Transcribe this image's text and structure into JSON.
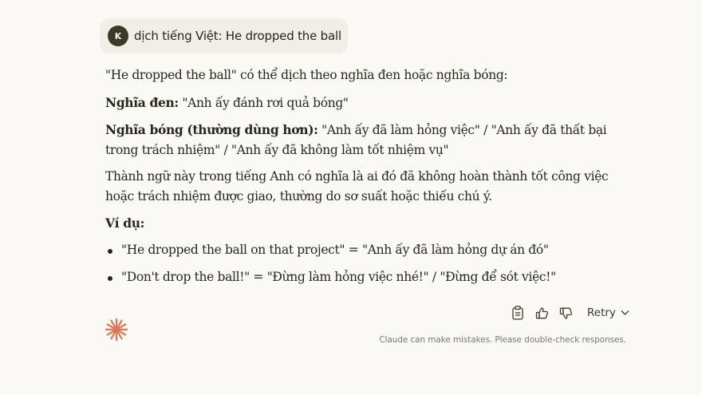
{
  "user_message": {
    "avatar_initial": "K",
    "text": "dịch tiếng Việt: He dropped the ball"
  },
  "response": {
    "intro": "\"He dropped the ball\" có thể dịch theo nghĩa đen hoặc nghĩa bóng:",
    "literal": {
      "label": "Nghĩa đen:",
      "text": " \"Anh ấy đánh rơi quả bóng\""
    },
    "figurative": {
      "label": "Nghĩa bóng (thường dùng hơn):",
      "text": " \"Anh ấy đã làm hỏng việc\" / \"Anh ấy đã thất bại trong trách nhiệm\" / \"Anh ấy đã không làm tốt nhiệm vụ\""
    },
    "explanation": "Thành ngữ này trong tiếng Anh có nghĩa là ai đó đã không hoàn thành tốt công việc hoặc trách nhiệm được giao, thường do sơ suất hoặc thiếu chú ý.",
    "examples_label": "Ví dụ:",
    "examples": [
      "\"He dropped the ball on that project\" = \"Anh ấy đã làm hỏng dự án đó\"",
      "\"Don't drop the ball!\" = \"Đừng làm hỏng việc nhé!\" / \"Đừng để sót việc!\""
    ]
  },
  "actions": {
    "retry_label": "Retry",
    "icons": [
      "copy-icon",
      "thumbs-up-icon",
      "thumbs-down-icon",
      "chevron-down-icon"
    ]
  },
  "disclaimer": "Claude can make mistakes. Please double-check responses.",
  "colors": {
    "background": "#faf9f5",
    "user_bubble": "#f0eee6",
    "avatar": "#3d3929",
    "logo": "#d97757",
    "text": "#29261b",
    "muted": "#7a776d"
  }
}
